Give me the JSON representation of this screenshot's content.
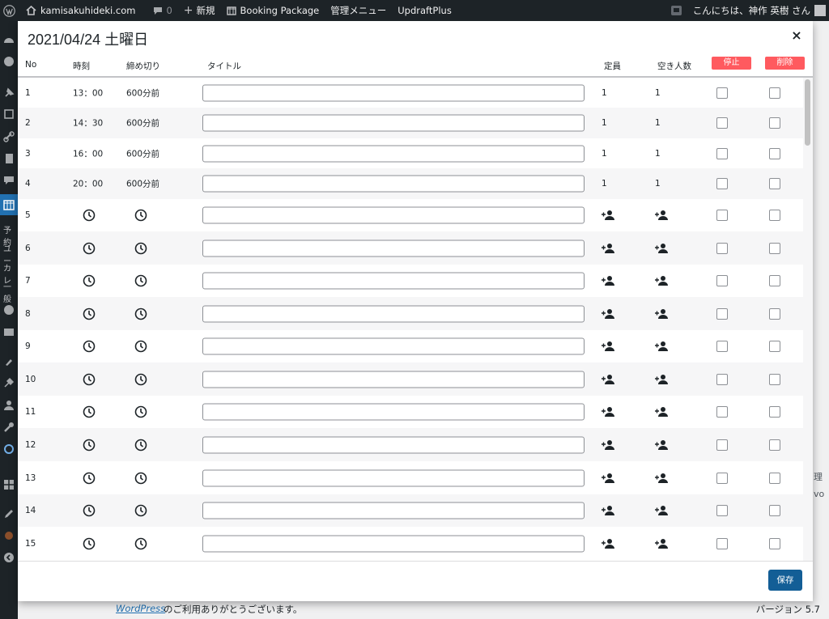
{
  "admin_bar": {
    "site_name": "kamisakuhideki.com",
    "comments_count": "0",
    "new_label": "新規",
    "booking_label": "Booking Package",
    "manage_label": "管理メニュー",
    "updraft_label": "UpdraftPlus",
    "greeting": "こんにちは、神作 英樹 さん"
  },
  "sidebar": {
    "icons": [
      "dashboard-icon",
      "jetpack-icon",
      "pin-icon",
      "media-icon",
      "link-icon",
      "pages-icon",
      "comments-icon",
      "calendar-icon",
      "plugin-icon",
      "mail-icon",
      "appearance-icon",
      "plugins-icon",
      "users-icon",
      "tools-icon",
      "settings-icon",
      "update-icon",
      "grid-icon",
      "edit-icon",
      "slider-icon",
      "collapse-icon"
    ],
    "sub_hints": [
      "予約",
      "ユー",
      "カレ",
      "一般"
    ]
  },
  "background": {
    "wp_link": "WordPress",
    "thanks": " のご利用ありがとうございます。",
    "version": "バージョン 5.7",
    "frag_1": "理",
    "frag_2": "vo"
  },
  "modal": {
    "title": "2021/04/24 土曜日",
    "close_label": "×",
    "headers": {
      "no": "No",
      "time": "時刻",
      "deadline": "締め切り",
      "title": "タイトル",
      "capacity": "定員",
      "available": "空き人数",
      "stop_button": "停止",
      "delete_button": "削除"
    },
    "rows": [
      {
        "no": "1",
        "time": "13：00",
        "deadline": "600分前",
        "title": "",
        "capacity": "1",
        "available": "1"
      },
      {
        "no": "2",
        "time": "14：30",
        "deadline": "600分前",
        "title": "",
        "capacity": "1",
        "available": "1"
      },
      {
        "no": "3",
        "time": "16：00",
        "deadline": "600分前",
        "title": "",
        "capacity": "1",
        "available": "1"
      },
      {
        "no": "4",
        "time": "20：00",
        "deadline": "600分前",
        "title": "",
        "capacity": "1",
        "available": "1"
      },
      {
        "no": "5",
        "time": "",
        "deadline": "",
        "title": "",
        "capacity": "",
        "available": ""
      },
      {
        "no": "6",
        "time": "",
        "deadline": "",
        "title": "",
        "capacity": "",
        "available": ""
      },
      {
        "no": "7",
        "time": "",
        "deadline": "",
        "title": "",
        "capacity": "",
        "available": ""
      },
      {
        "no": "8",
        "time": "",
        "deadline": "",
        "title": "",
        "capacity": "",
        "available": ""
      },
      {
        "no": "9",
        "time": "",
        "deadline": "",
        "title": "",
        "capacity": "",
        "available": ""
      },
      {
        "no": "10",
        "time": "",
        "deadline": "",
        "title": "",
        "capacity": "",
        "available": ""
      },
      {
        "no": "11",
        "time": "",
        "deadline": "",
        "title": "",
        "capacity": "",
        "available": ""
      },
      {
        "no": "12",
        "time": "",
        "deadline": "",
        "title": "",
        "capacity": "",
        "available": ""
      },
      {
        "no": "13",
        "time": "",
        "deadline": "",
        "title": "",
        "capacity": "",
        "available": ""
      },
      {
        "no": "14",
        "time": "",
        "deadline": "",
        "title": "",
        "capacity": "",
        "available": ""
      },
      {
        "no": "15",
        "time": "",
        "deadline": "",
        "title": "",
        "capacity": "",
        "available": ""
      }
    ],
    "save_label": "保存"
  },
  "colors": {
    "admin_bar": "#1d2327",
    "accent_red": "#ff5a5f",
    "save_blue": "#135e96",
    "calendar_highlight": "#2271b1"
  }
}
